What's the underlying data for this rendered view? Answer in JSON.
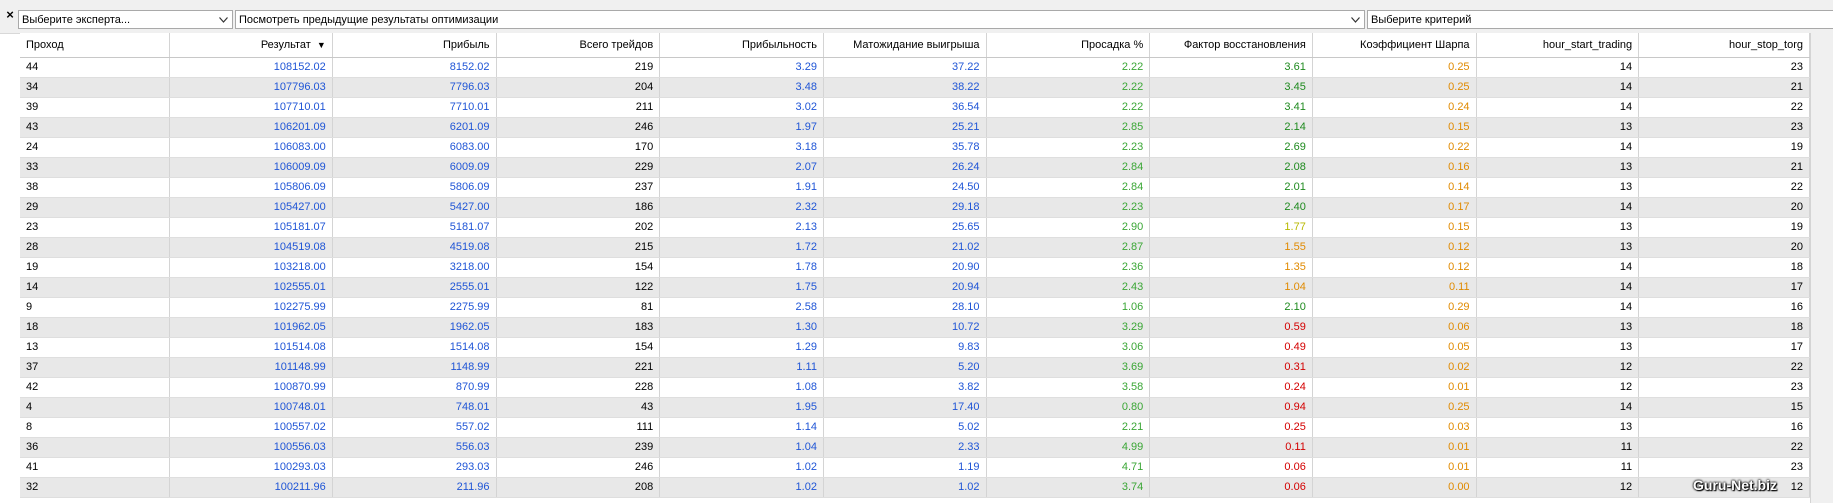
{
  "toolbar": {
    "close_icon": "×",
    "expert_select": "Выберите эксперта...",
    "previous_results_select": "Посмотреть предыдущие результаты оптимизации",
    "criterion_select": "Выберите критерий"
  },
  "colors": {
    "blue": "#1f55d6",
    "dark_green": "#1e8a1e",
    "green": "#3aa635",
    "yellow_green": "#b8b800",
    "orange": "#e08a00",
    "red": "#d40000"
  },
  "columns": [
    "Проход",
    "Результат",
    "Прибыль",
    "Всего трейдов",
    "Прибыльность",
    "Матожидание выигрыша",
    "Просадка %",
    "Фактор восстановления",
    "Коэффициент Шарпа",
    "hour_start_trading",
    "hour_stop_torg"
  ],
  "sort_indicator": "▼",
  "rows": [
    [
      "44",
      "108152.02",
      "8152.02",
      "219",
      "3.29",
      "37.22",
      "2.22",
      "3.61",
      "0.25",
      "14",
      "23"
    ],
    [
      "34",
      "107796.03",
      "7796.03",
      "204",
      "3.48",
      "38.22",
      "2.22",
      "3.45",
      "0.25",
      "14",
      "21"
    ],
    [
      "39",
      "107710.01",
      "7710.01",
      "211",
      "3.02",
      "36.54",
      "2.22",
      "3.41",
      "0.24",
      "14",
      "22"
    ],
    [
      "43",
      "106201.09",
      "6201.09",
      "246",
      "1.97",
      "25.21",
      "2.85",
      "2.14",
      "0.15",
      "13",
      "23"
    ],
    [
      "24",
      "106083.00",
      "6083.00",
      "170",
      "3.18",
      "35.78",
      "2.23",
      "2.69",
      "0.22",
      "14",
      "19"
    ],
    [
      "33",
      "106009.09",
      "6009.09",
      "229",
      "2.07",
      "26.24",
      "2.84",
      "2.08",
      "0.16",
      "13",
      "21"
    ],
    [
      "38",
      "105806.09",
      "5806.09",
      "237",
      "1.91",
      "24.50",
      "2.84",
      "2.01",
      "0.14",
      "13",
      "22"
    ],
    [
      "29",
      "105427.00",
      "5427.00",
      "186",
      "2.32",
      "29.18",
      "2.23",
      "2.40",
      "0.17",
      "14",
      "20"
    ],
    [
      "23",
      "105181.07",
      "5181.07",
      "202",
      "2.13",
      "25.65",
      "2.90",
      "1.77",
      "0.15",
      "13",
      "19"
    ],
    [
      "28",
      "104519.08",
      "4519.08",
      "215",
      "1.72",
      "21.02",
      "2.87",
      "1.55",
      "0.12",
      "13",
      "20"
    ],
    [
      "19",
      "103218.00",
      "3218.00",
      "154",
      "1.78",
      "20.90",
      "2.36",
      "1.35",
      "0.12",
      "14",
      "18"
    ],
    [
      "14",
      "102555.01",
      "2555.01",
      "122",
      "1.75",
      "20.94",
      "2.43",
      "1.04",
      "0.11",
      "14",
      "17"
    ],
    [
      "9",
      "102275.99",
      "2275.99",
      "81",
      "2.58",
      "28.10",
      "1.06",
      "2.10",
      "0.29",
      "14",
      "16"
    ],
    [
      "18",
      "101962.05",
      "1962.05",
      "183",
      "1.30",
      "10.72",
      "3.29",
      "0.59",
      "0.06",
      "13",
      "18"
    ],
    [
      "13",
      "101514.08",
      "1514.08",
      "154",
      "1.29",
      "9.83",
      "3.06",
      "0.49",
      "0.05",
      "13",
      "17"
    ],
    [
      "37",
      "101148.99",
      "1148.99",
      "221",
      "1.11",
      "5.20",
      "3.69",
      "0.31",
      "0.02",
      "12",
      "22"
    ],
    [
      "42",
      "100870.99",
      "870.99",
      "228",
      "1.08",
      "3.82",
      "3.58",
      "0.24",
      "0.01",
      "12",
      "23"
    ],
    [
      "4",
      "100748.01",
      "748.01",
      "43",
      "1.95",
      "17.40",
      "0.80",
      "0.94",
      "0.25",
      "14",
      "15"
    ],
    [
      "8",
      "100557.02",
      "557.02",
      "111",
      "1.14",
      "5.02",
      "2.21",
      "0.25",
      "0.03",
      "13",
      "16"
    ],
    [
      "36",
      "100556.03",
      "556.03",
      "239",
      "1.04",
      "2.33",
      "4.99",
      "0.11",
      "0.01",
      "11",
      "22"
    ],
    [
      "41",
      "100293.03",
      "293.03",
      "246",
      "1.02",
      "1.19",
      "4.71",
      "0.06",
      "0.01",
      "11",
      "23"
    ],
    [
      "32",
      "100211.96",
      "211.96",
      "208",
      "1.02",
      "1.02",
      "3.74",
      "0.06",
      "0.00",
      "12",
      "12"
    ]
  ],
  "watermark": "Guru-Net.biz"
}
